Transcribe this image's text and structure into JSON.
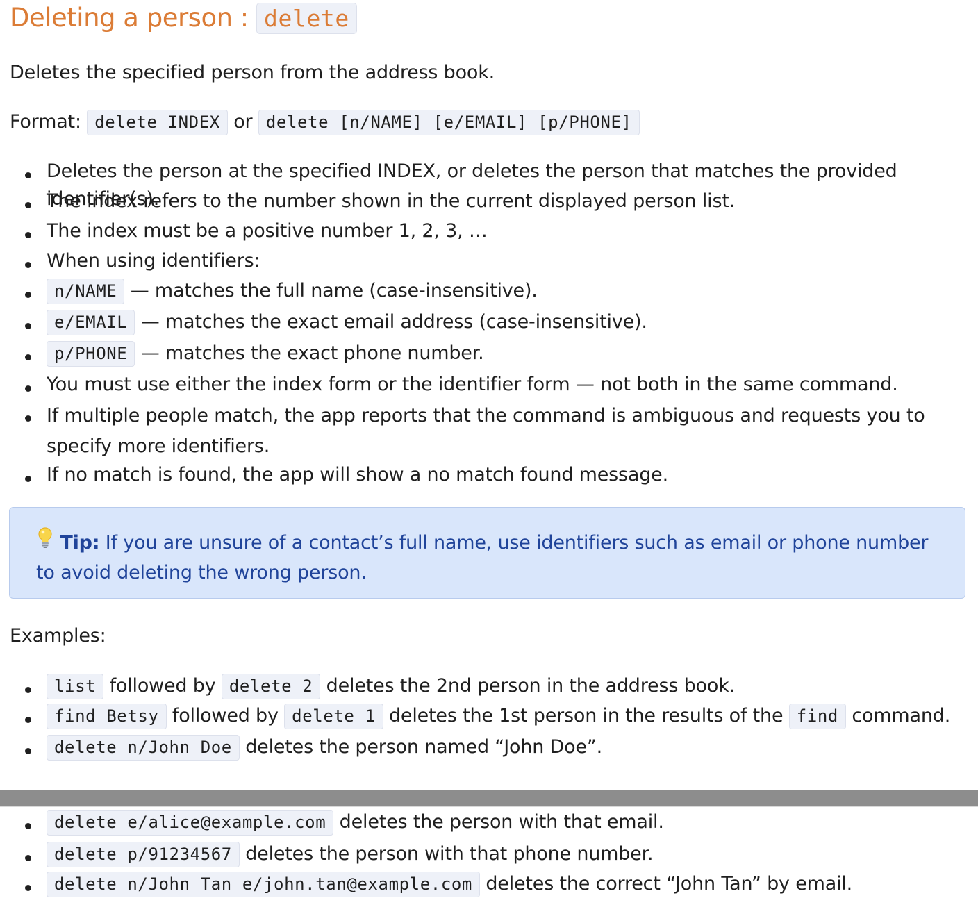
{
  "heading": {
    "text": "Deleting a person :",
    "command": "delete"
  },
  "description": "Deletes the specified person from the address book.",
  "format": {
    "label": "Format:",
    "code1": "delete INDEX",
    "connector": "or",
    "code2": "delete [n/NAME] [e/EMAIL] [p/PHONE]"
  },
  "rules": [
    "Deletes the person at the specified INDEX, or deletes the person that matches the provided identifier(s).",
    "The index refers to the number shown in the current displayed person list.",
    "The index must be a positive number 1, 2, 3, …",
    "When using identifiers:",
    {
      "code": "n/NAME",
      "text": "— matches the full name (case-insensitive)."
    },
    {
      "code": "e/EMAIL",
      "text": "— matches the exact email address (case-insensitive)."
    },
    {
      "code": "p/PHONE",
      "text": "— matches the exact phone number."
    },
    "You must use either the index form or the identifier form — not both in the same command.",
    "If multiple people match, the app reports that the command is ambiguous and requests you to specify more identifiers.",
    "If no match is found, the app will show a no match found message."
  ],
  "tip": {
    "icon": "lightbulb-icon",
    "label": "Tip:",
    "text": "If you are unsure of a contact’s full name, use identifiers such as email or phone number to avoid deleting the wrong person."
  },
  "examples_label": "Examples:",
  "examples": [
    {
      "c1": "list",
      "t1": "followed by",
      "c2": "delete 2",
      "t2": "deletes the 2nd person in the address book."
    },
    {
      "c1": "find Betsy",
      "t1": "followed by",
      "c2": "delete 1",
      "t2": "deletes the 1st person in the results of the",
      "c3": "find",
      "t3": "command."
    },
    {
      "c1": "delete n/John Doe",
      "t1": "deletes the person named “John Doe”."
    }
  ],
  "examples_more": [
    {
      "c1": "delete e/alice@example.com",
      "t1": "deletes the person with that email."
    },
    {
      "c1": "delete p/91234567",
      "t1": "deletes the person with that phone number."
    },
    {
      "c1": "delete n/John Tan e/john.tan@example.com",
      "t1": "deletes the correct “John Tan” by email."
    }
  ],
  "colors": {
    "heading": "#db7c36",
    "tip_background": "#d9e6fb",
    "tip_text": "#20449a"
  }
}
